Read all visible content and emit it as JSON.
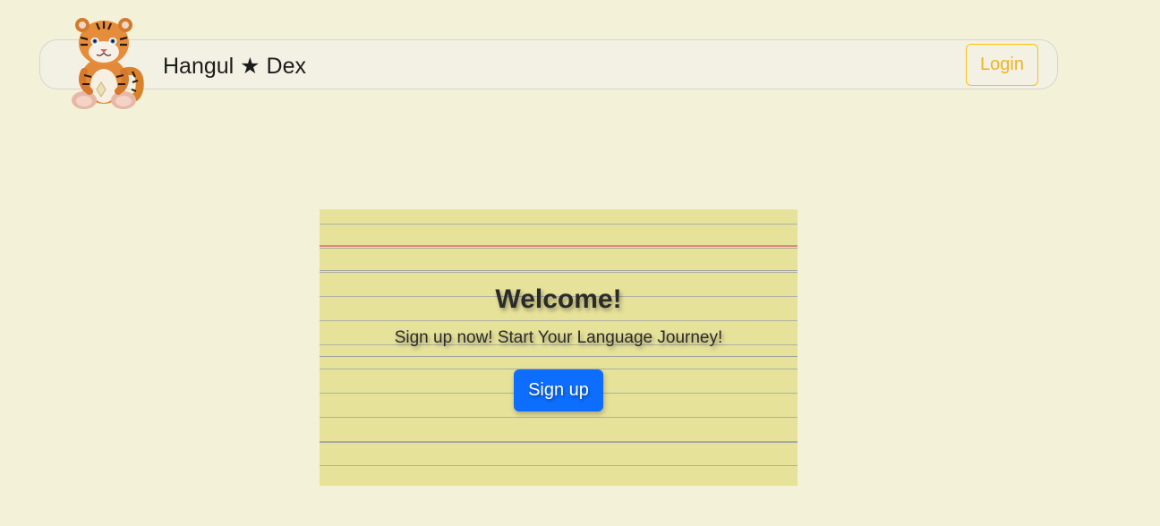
{
  "header": {
    "brand": "Hangul ★ Dex",
    "login_label": "Login",
    "logo_icon": "tiger-cub-icon"
  },
  "hero": {
    "title": "Welcome!",
    "tagline": "Sign up now! Start Your Language Journey!",
    "signup_label": "Sign up"
  },
  "colors": {
    "page_background": "#f3f2d9",
    "navbar_background": "#f2f1e4",
    "login_border": "#ffc107",
    "login_text": "#f0b323",
    "card_paper": "#e7e29a",
    "card_margin_line": "#dc8a73",
    "signup_button": "#0d6efd"
  }
}
